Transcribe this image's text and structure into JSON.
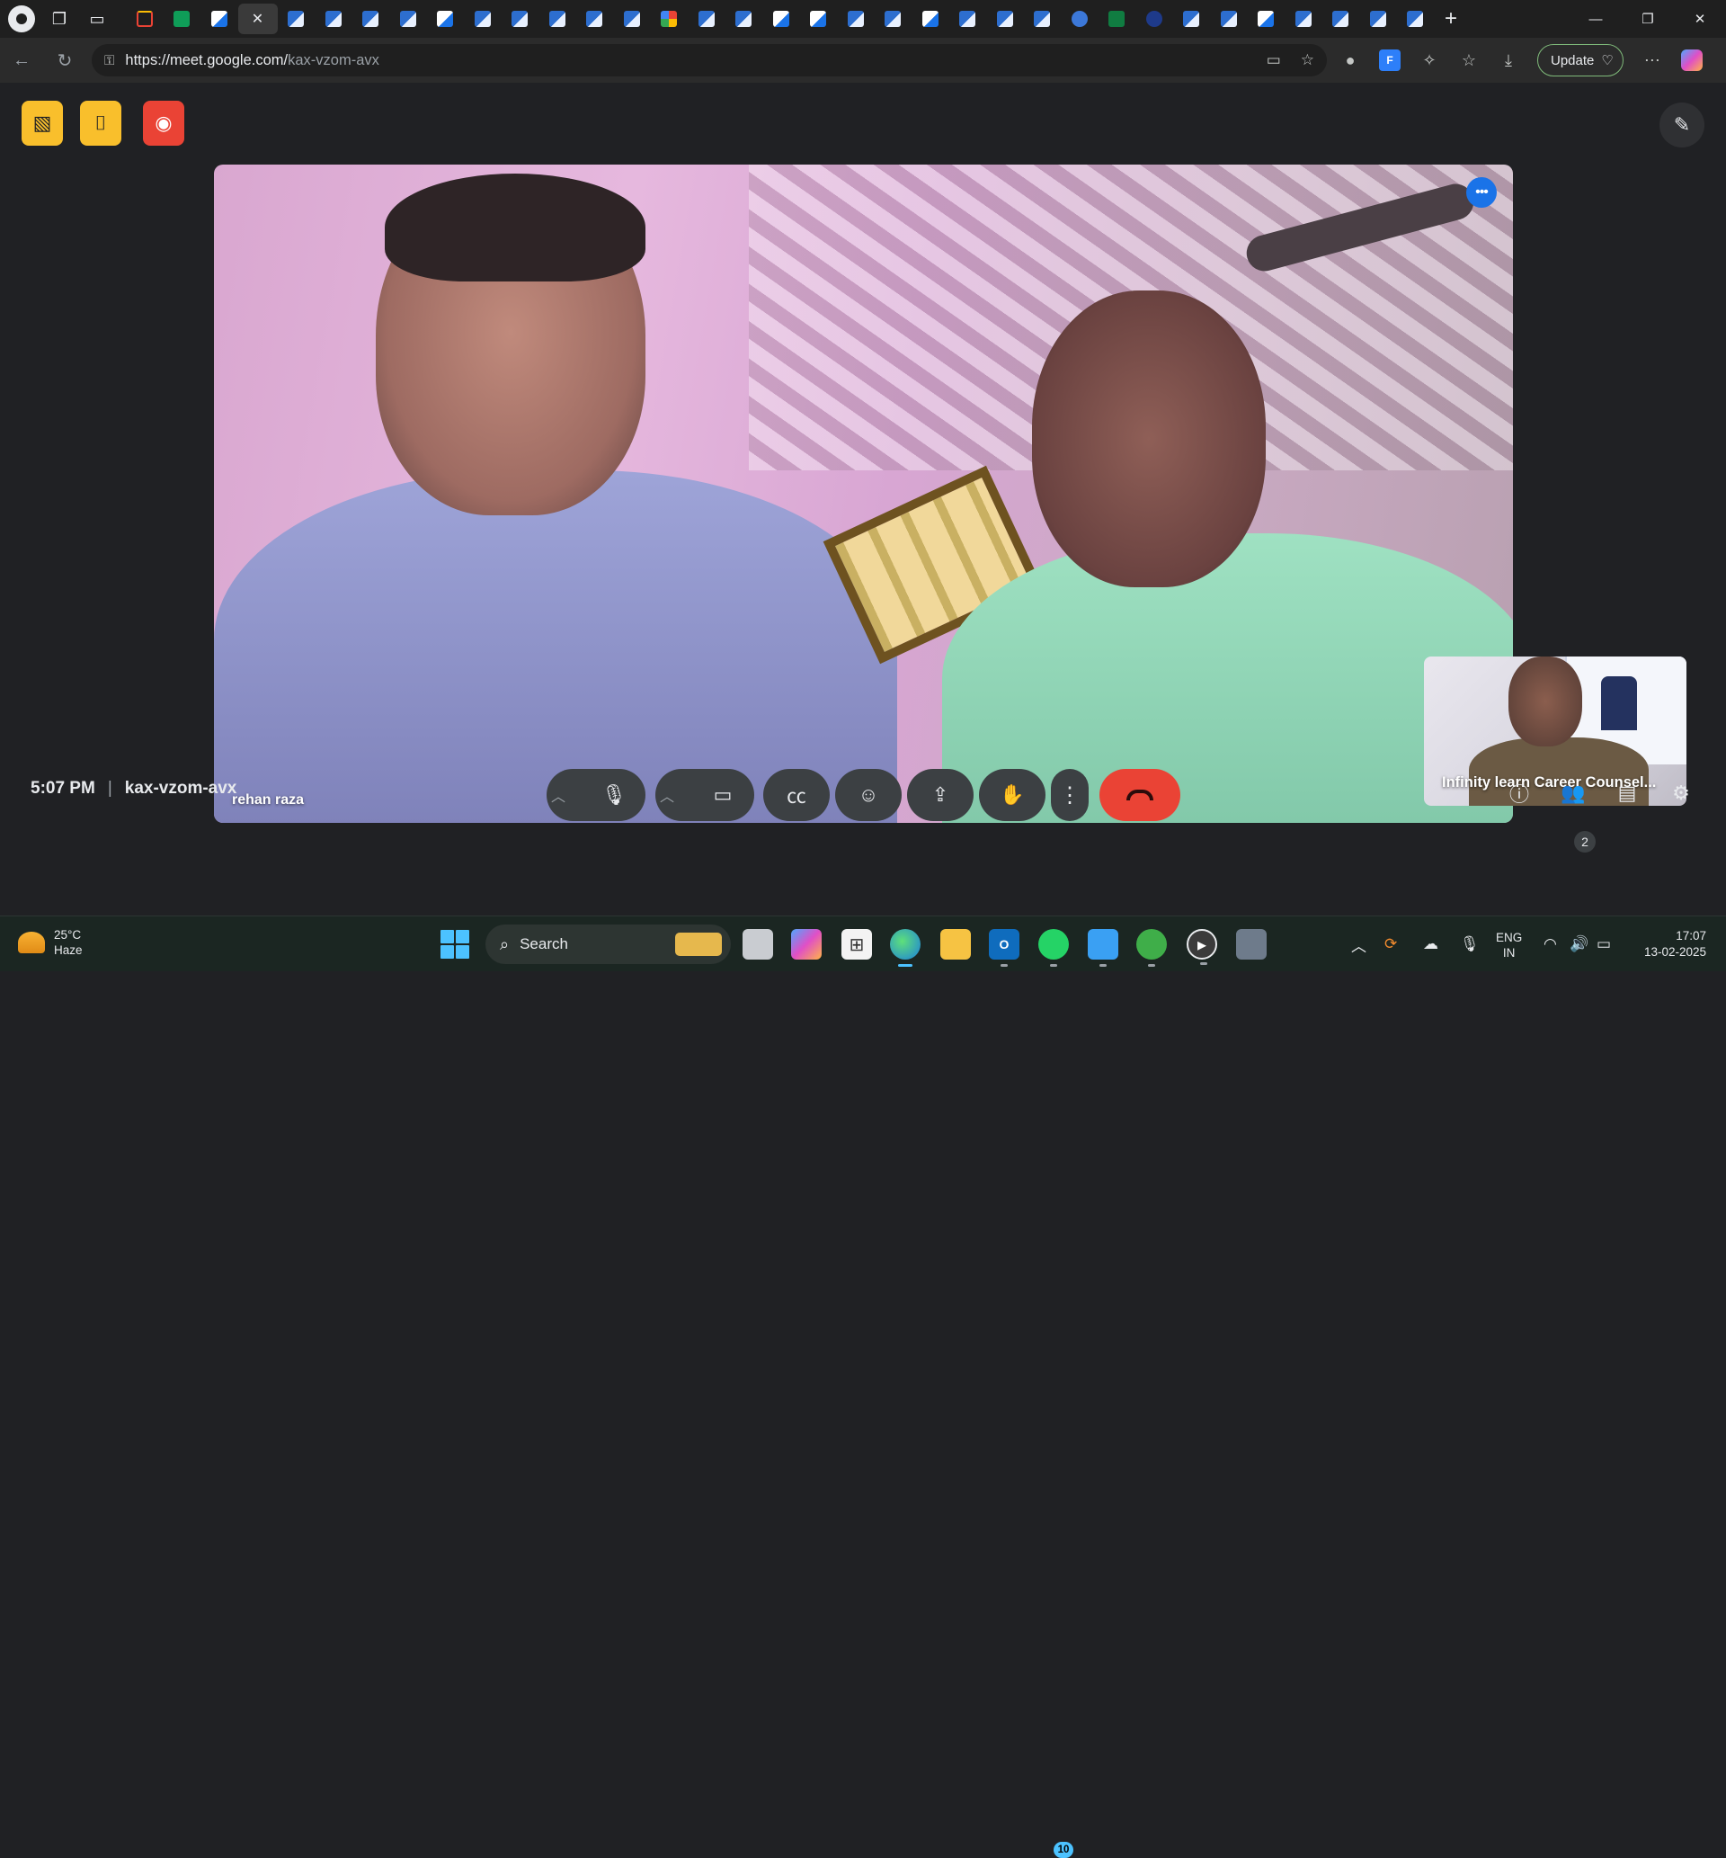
{
  "browser": {
    "url_host": "https://meet.google.com/",
    "url_path": "kax-vzom-avx",
    "update_label": "Update",
    "tabs": [
      {
        "icon": "gmail-icon"
      },
      {
        "icon": "sheets-icon"
      },
      {
        "icon": "docs-icon"
      },
      {
        "icon": "active-tab",
        "active": true
      }
    ]
  },
  "meet": {
    "main_participant": "rehan raza",
    "self_participant": "Infinity learn Career Counsel...",
    "time": "5:07 PM",
    "meeting_code": "kax-vzom-avx",
    "people_count": "2"
  },
  "taskbar": {
    "temperature": "25°C",
    "weather": "Haze",
    "search_placeholder": "Search",
    "whatsapp_badge": "10",
    "lang_1": "ENG",
    "lang_2": "IN",
    "time": "17:07",
    "date": "13-02-2025"
  },
  "colors": {
    "host_controls": "#f9bf2c",
    "record": "#ea4335",
    "end_call": "#ea4335",
    "accent": "#1a73e8"
  }
}
